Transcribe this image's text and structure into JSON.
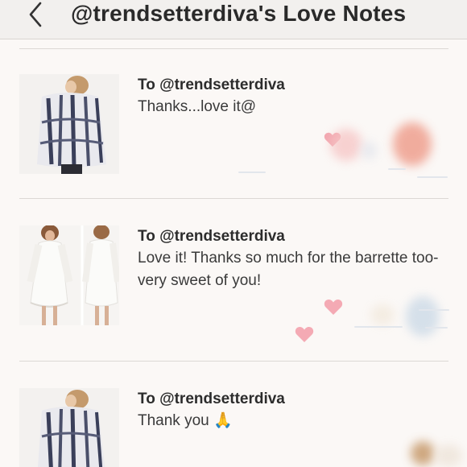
{
  "header": {
    "title": "@trendsetterdiva's Love Notes"
  },
  "notes": [
    {
      "to": "To @trendsetterdiva",
      "message": "Thanks...love it@"
    },
    {
      "to": "To @trendsetterdiva",
      "message": "Love it! Thanks so much for the barrette too- very sweet of you!"
    },
    {
      "to": "To @trendsetterdiva",
      "message": "Thank you 🙏"
    }
  ],
  "colors": {
    "background": "#fbf8f6",
    "header_bg": "#f2f0ee",
    "divider": "#dcd8d5",
    "heart": "#f4a9b0"
  }
}
